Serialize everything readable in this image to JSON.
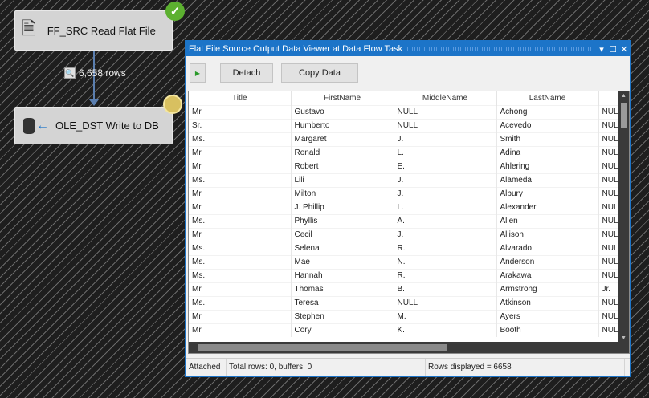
{
  "flow": {
    "source": {
      "label": "FF_SRC Read Flat File",
      "status": "success"
    },
    "path": {
      "rows_label": "6,658 rows"
    },
    "destination": {
      "label": "OLE_DST Write to DB",
      "status": "running"
    }
  },
  "viewer": {
    "title": "Flat File Source Output Data Viewer at Data Flow Task",
    "controls": {
      "menu": "▾",
      "maximize": "☐",
      "close": "✕"
    },
    "toolbar": {
      "play": "▶",
      "detach": "Detach",
      "copy": "Copy Data"
    },
    "columns": [
      "Title",
      "FirstName",
      "MiddleName",
      "LastName",
      ""
    ],
    "rows": [
      [
        "Mr.",
        "Gustavo",
        "NULL",
        "Achong",
        "NULL"
      ],
      [
        "Sr.",
        "Humberto",
        "NULL",
        "Acevedo",
        "NULL"
      ],
      [
        "Ms.",
        "Margaret",
        "J.",
        "Smith",
        "NULL"
      ],
      [
        "Mr.",
        "Ronald",
        "L.",
        "Adina",
        "NULL"
      ],
      [
        "Mr.",
        "Robert",
        "E.",
        "Ahlering",
        "NULL"
      ],
      [
        "Ms.",
        "Lili",
        "J.",
        "Alameda",
        "NULL"
      ],
      [
        "Mr.",
        "Milton",
        "J.",
        "Albury",
        "NULL"
      ],
      [
        "Mr.",
        "J. Phillip",
        "L.",
        "Alexander",
        "NULL"
      ],
      [
        "Ms.",
        "Phyllis",
        "A.",
        "Allen",
        "NULL"
      ],
      [
        "Mr.",
        "Cecil",
        "J.",
        "Allison",
        "NULL"
      ],
      [
        "Ms.",
        "Selena",
        "R.",
        "Alvarado",
        "NULL"
      ],
      [
        "Ms.",
        "Mae",
        "N.",
        "Anderson",
        "NULL"
      ],
      [
        "Ms.",
        "Hannah",
        "R.",
        "Arakawa",
        "NULL"
      ],
      [
        "Mr.",
        "Thomas",
        "B.",
        "Armstrong",
        "Jr."
      ],
      [
        "Ms.",
        "Teresa",
        "NULL",
        "Atkinson",
        "NULL"
      ],
      [
        "Mr.",
        "Stephen",
        "M.",
        "Ayers",
        "NULL"
      ],
      [
        "Mr.",
        "Cory",
        "K.",
        "Booth",
        "NULL"
      ]
    ],
    "status": {
      "state": "Attached",
      "totals": "Total rows: 0, buffers: 0",
      "displayed": "Rows displayed = 6658"
    }
  }
}
